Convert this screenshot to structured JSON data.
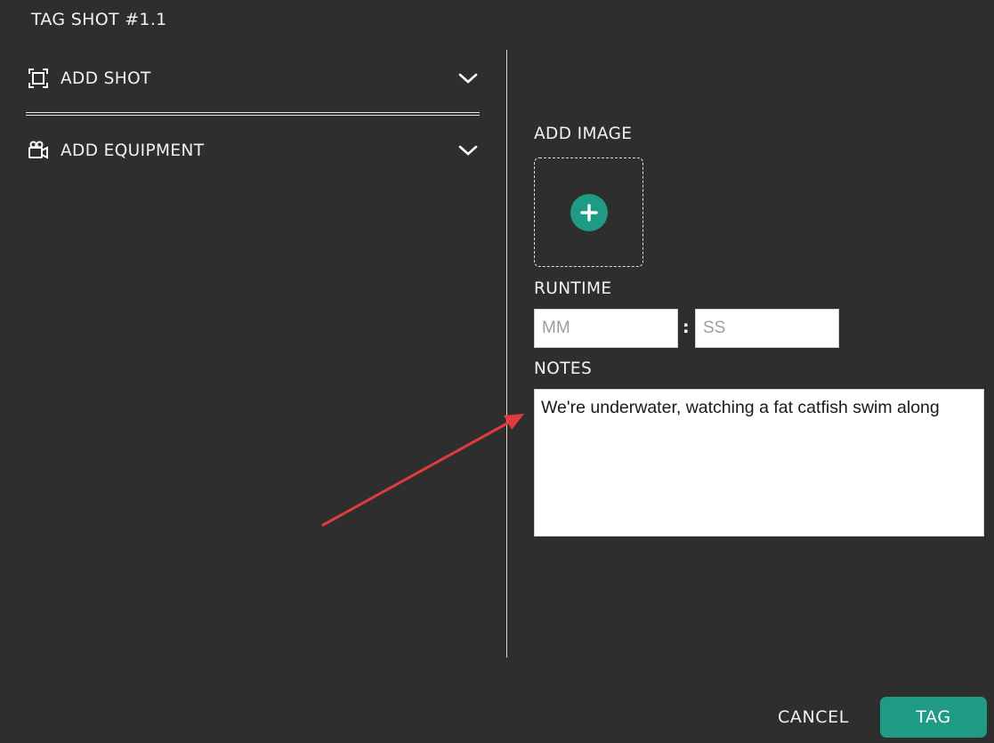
{
  "dialog": {
    "title": "TAG SHOT #1.1"
  },
  "left_panel": {
    "sections": [
      {
        "label": "ADD SHOT",
        "icon": "frame-icon",
        "expanded": false
      },
      {
        "label": "ADD EQUIPMENT",
        "icon": "video-camera-icon",
        "expanded": false
      }
    ]
  },
  "right_panel": {
    "image_label": "ADD IMAGE",
    "runtime_label": "RUNTIME",
    "runtime": {
      "minutes_placeholder": "MM",
      "separator": ":",
      "seconds_placeholder": "SS",
      "minutes_value": "",
      "seconds_value": ""
    },
    "notes_label": "NOTES",
    "notes_value": "We're underwater, watching a fat catfish swim along"
  },
  "footer": {
    "cancel_label": "CANCEL",
    "tag_label": "TAG"
  },
  "colors": {
    "background": "#2e2e2e",
    "accent": "#1f9a84",
    "annotation_arrow": "#e03c3c"
  }
}
